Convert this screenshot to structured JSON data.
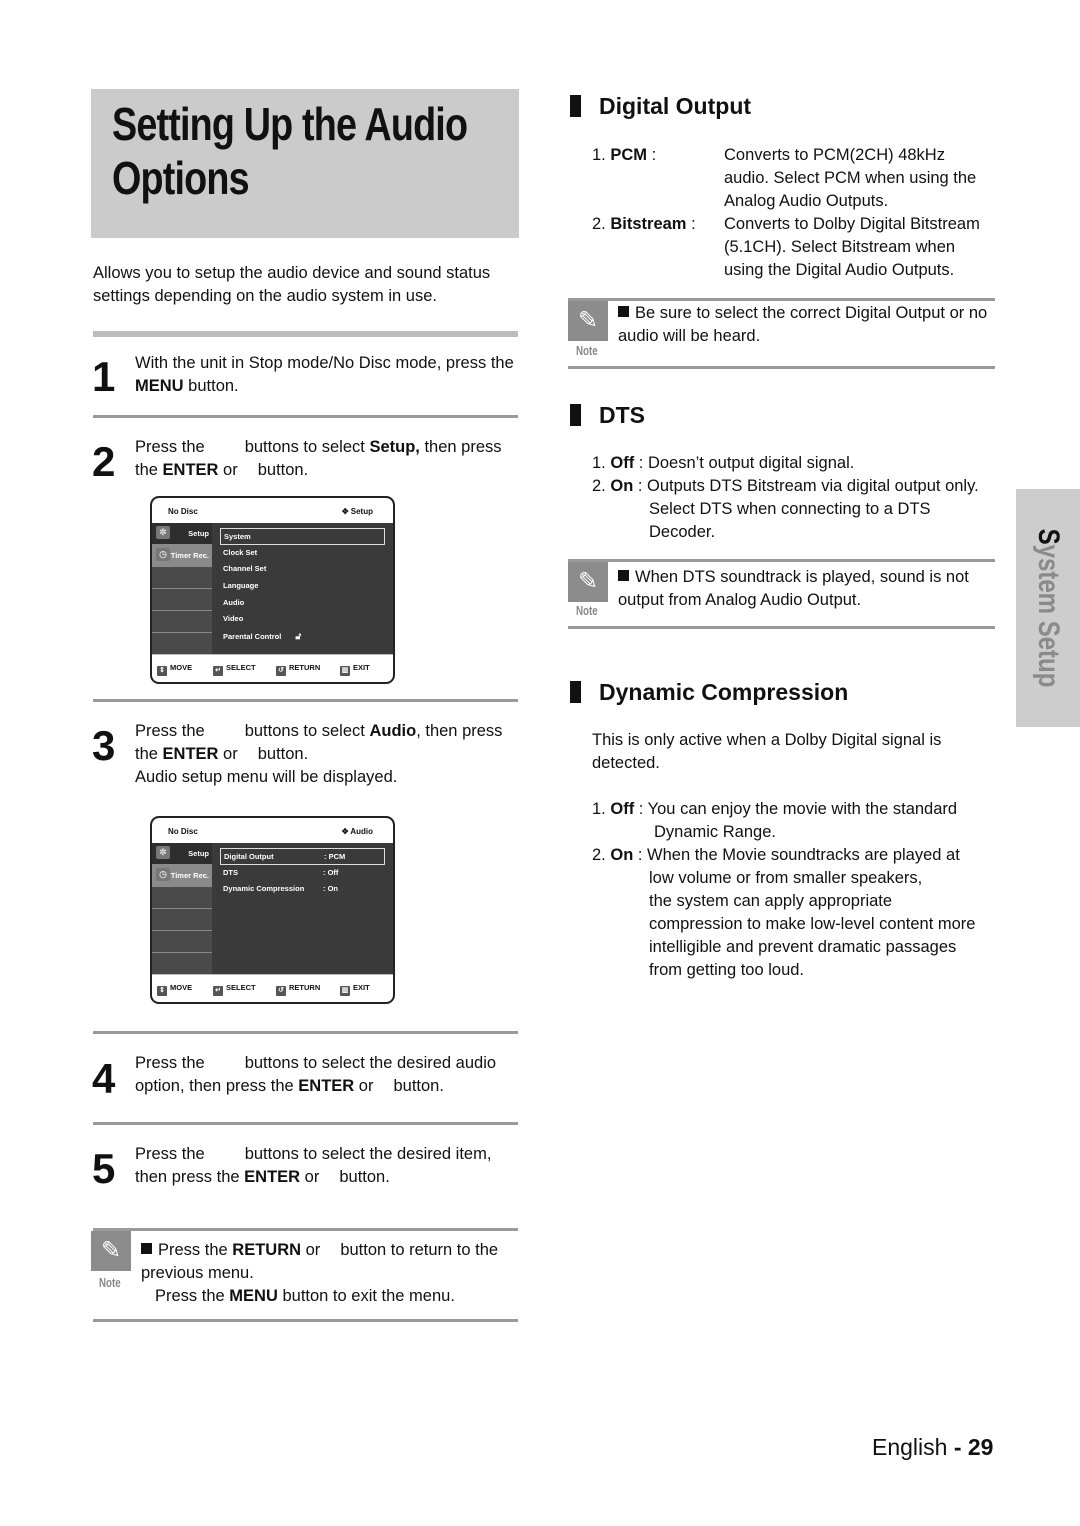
{
  "page": {
    "title_line1": "Setting Up the Audio",
    "title_line2": "Options",
    "intro": "Allows you to setup the audio device and sound status settings depending on the audio system in use.",
    "side_tab": {
      "first": "S",
      "rest": "ystem Setup"
    },
    "footer": {
      "lang": "English",
      "sep": " - ",
      "page": "29"
    }
  },
  "steps": [
    {
      "num": "1",
      "a": "With the unit in Stop mode/No Disc mode, press the ",
      "b": "MENU",
      "c": " button."
    },
    {
      "num": "2",
      "a": "Press the",
      "a2": "buttons to select ",
      "b": "Setup,",
      "c": " then press the ",
      "d": "ENTER",
      "e": " or",
      "f": "button."
    },
    {
      "num": "3",
      "a": "Press the",
      "a2": "buttons to select ",
      "b": "Audio",
      "c": ", then press the ",
      "d": "ENTER",
      "e": " or",
      "f": "button.",
      "g": "Audio setup menu will be displayed."
    },
    {
      "num": "4",
      "a": "Press the",
      "a2": "buttons to select the desired audio option, then press the ",
      "d": "ENTER",
      "e": " or",
      "f": "button."
    },
    {
      "num": "5",
      "a": "Press the",
      "a2": "buttons to select the desired item, then press the ",
      "d": "ENTER",
      "e": " or",
      "f": "button."
    }
  ],
  "osd_setup": {
    "top_left": "No Disc",
    "top_right": "Setup",
    "tabs": [
      "Setup",
      "Timer Rec."
    ],
    "items": [
      "System",
      "Clock Set",
      "Channel Set",
      "Language",
      "Audio",
      "Video",
      "Parental Control"
    ],
    "buttons": [
      "MOVE",
      "SELECT",
      "RETURN",
      "EXIT"
    ]
  },
  "osd_audio": {
    "top_left": "No Disc",
    "top_right": "Audio",
    "tabs": [
      "Setup",
      "Timer Rec."
    ],
    "items": [
      {
        "label": "Digital Output",
        "value": ": PCM"
      },
      {
        "label": "DTS",
        "value": ": Off"
      },
      {
        "label": "Dynamic Compression",
        "value": ": On"
      }
    ],
    "buttons": [
      "MOVE",
      "SELECT",
      "RETURN",
      "EXIT"
    ]
  },
  "left_note": {
    "label": "Note",
    "a": "Press the ",
    "b": "RETURN",
    "c": " or",
    "d": "button to return to the previous menu.",
    "e": "Press the ",
    "f": "MENU",
    "g": " button to exit the menu."
  },
  "digital_output": {
    "heading": "Digital Output",
    "items": [
      {
        "num": "1. ",
        "key": "PCM",
        "sep": " :",
        "desc": [
          "Converts to PCM(2CH) 48kHz",
          "audio. Select PCM when using the",
          "Analog Audio Outputs."
        ]
      },
      {
        "num": "2. ",
        "key": "Bitstream",
        "sep": " :",
        "desc": [
          "Converts to Dolby Digital Bitstream",
          "(5.1CH). Select Bitstream when",
          "using the Digital Audio Outputs."
        ]
      }
    ],
    "note": {
      "label": "Note",
      "text": "Be sure to select the correct Digital Output or no audio will be heard."
    }
  },
  "dts": {
    "heading": "DTS",
    "items": [
      {
        "num": "1. ",
        "key": "Off",
        "desc": " : Doesn’t output digital signal."
      },
      {
        "num": "2. ",
        "key": "On",
        "desc": " : Outputs DTS Bitstream via digital output only.",
        "more": [
          "Select DTS when connecting to a DTS",
          "Decoder."
        ]
      }
    ],
    "note": {
      "label": "Note",
      "text": "When DTS soundtrack is played, sound is not output from Analog Audio Output."
    }
  },
  "dynamic_compression": {
    "heading": "Dynamic Compression",
    "intro": "This is only active when a Dolby Digital signal is detected.",
    "items": [
      {
        "num": "1. ",
        "key": "Off",
        "desc": " : You can enjoy the movie with the standard",
        "more": [
          "Dynamic Range."
        ]
      },
      {
        "num": "2. ",
        "key": "On",
        "desc": " : When the Movie soundtracks are played at",
        "more": [
          "low volume or from smaller speakers,",
          "the system can apply appropriate",
          "compression to make low-level content more",
          "intelligible and prevent dramatic passages",
          "from getting too loud."
        ]
      }
    ]
  }
}
